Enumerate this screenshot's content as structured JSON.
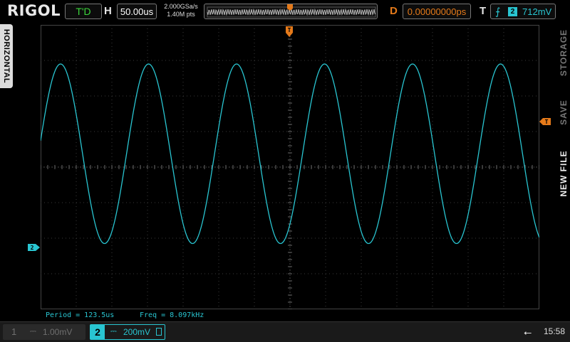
{
  "brand": "RIGOL",
  "header": {
    "trigger_status": "T'D",
    "h_label": "H",
    "timebase": "50.00us",
    "sample_rate": "2.000GSa/s",
    "memory_depth": "1.40M pts",
    "d_label": "D",
    "delay": "0.00000000ps",
    "t_label": "T",
    "trigger_channel": "2",
    "trigger_level": "712mV"
  },
  "side_menu": {
    "left_tab": "HORIZONTAL",
    "right_tabs": [
      "STORAGE",
      "SAVE",
      "NEW FILE"
    ]
  },
  "markers": {
    "trigger_pos": "T",
    "trigger_level_marker": "T",
    "channel_ground": "2"
  },
  "measurements": {
    "period": "Period = 123.5us",
    "freq": "Freq = 8.097kHz"
  },
  "channels": [
    {
      "number": "1",
      "scale": "1.00mV",
      "active": false
    },
    {
      "number": "2",
      "scale": "200mV",
      "active": true
    }
  ],
  "status": {
    "time": "15:58"
  },
  "colors": {
    "ch2": "#29c5d1",
    "trigger": "#e57a1a",
    "status_ok": "#3bd43b"
  },
  "chart_data": {
    "type": "line",
    "waveform": "sine",
    "channel": "2",
    "divisions": {
      "x": 14,
      "y": 8
    },
    "time_per_div_us": 50,
    "volts_per_div_mV": 200,
    "period_us": 123.5,
    "peak_div": 2.9,
    "trough_div": -2.15,
    "first_peak_time_us": 28
  }
}
